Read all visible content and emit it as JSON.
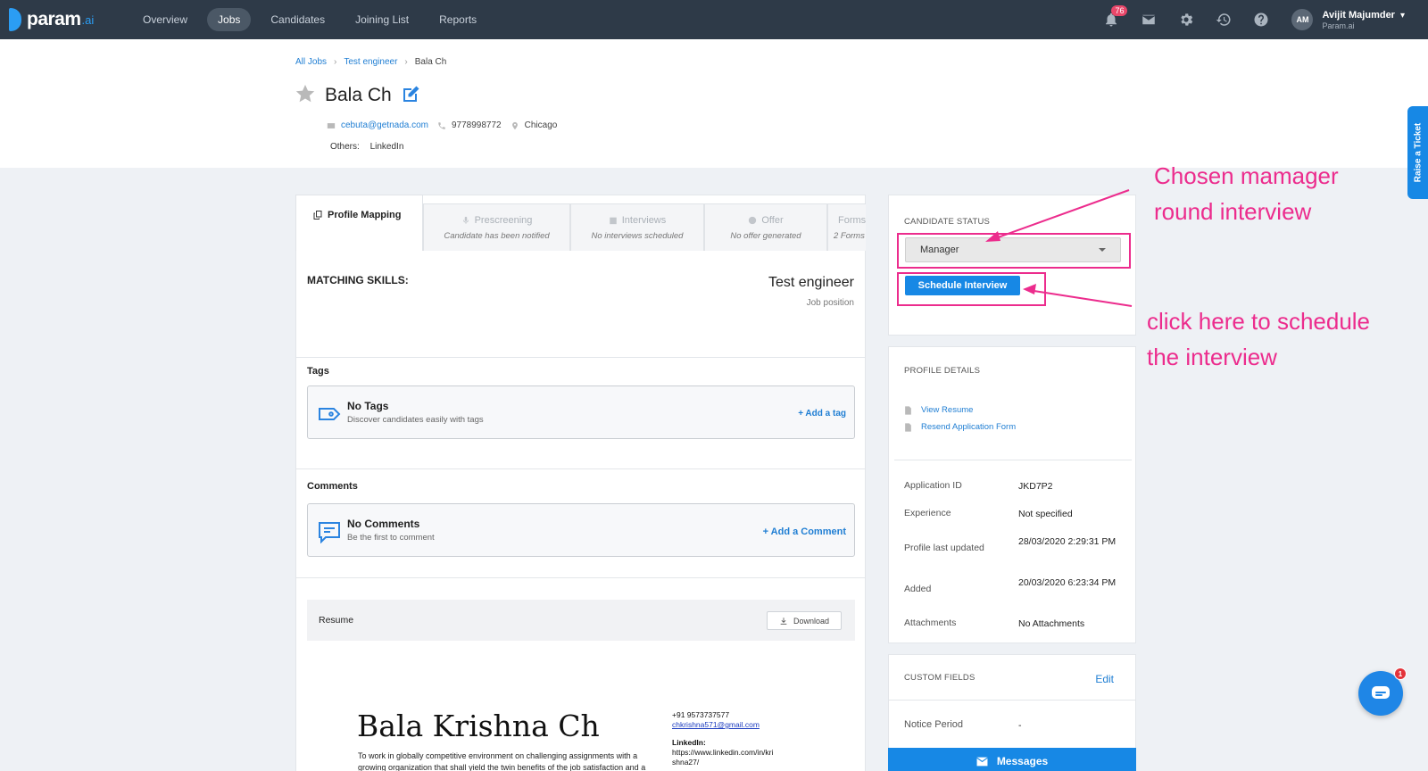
{
  "nav": {
    "logo_text": "param",
    "logo_suffix": ".ai",
    "items": [
      "Overview",
      "Jobs",
      "Candidates",
      "Joining List",
      "Reports"
    ],
    "notification_count": "76",
    "user_initials": "AM",
    "user_name": "Avijit Majumder",
    "user_org": "Param.ai"
  },
  "breadcrumb": {
    "all_jobs": "All Jobs",
    "job": "Test engineer",
    "current": "Bala Ch"
  },
  "candidate": {
    "name": "Bala Ch",
    "email": "cebuta@getnada.com",
    "phone": "9778998772",
    "city": "Chicago",
    "others_label": "Others:",
    "others_value": "LinkedIn"
  },
  "tabs": [
    {
      "title": "Profile Mapping",
      "sub": ""
    },
    {
      "title": "Prescreening",
      "sub": "Candidate has been notified"
    },
    {
      "title": "Interviews",
      "sub": "No interviews scheduled"
    },
    {
      "title": "Offer",
      "sub": "No offer generated"
    },
    {
      "title": "Forms",
      "sub": "2 Forms"
    }
  ],
  "profile": {
    "matching_skills": "MATCHING SKILLS:",
    "job_title": "Test engineer",
    "job_label": "Job position",
    "tags_label": "Tags",
    "tags_empty_title": "No Tags",
    "tags_empty_sub": "Discover candidates easily with tags",
    "tags_action": "+ Add a tag",
    "comments_label": "Comments",
    "comments_empty_title": "No Comments",
    "comments_empty_sub": "Be the first to comment",
    "comments_action": "+ Add a Comment",
    "resume_label": "Resume",
    "download_label": "Download"
  },
  "resume_preview": {
    "name": "Bala Krishna Ch",
    "objective": "To work in globally competitive environment on challenging assignments with a growing organization that shall yield the twin benefits of the job satisfaction and a",
    "phone": "+91 9573737577",
    "email": "chkrishna571@gmail.com",
    "linkedin_label": "LinkedIn:",
    "linkedin_line1": "https://www.linkedin.com/in/kri",
    "linkedin_line2": "shna27/"
  },
  "status_card": {
    "label": "CANDIDATE STATUS",
    "selected": "Manager",
    "schedule_button": "Schedule Interview"
  },
  "profile_details": {
    "label": "PROFILE DETAILS",
    "view_resume": "View Resume",
    "resend_form": "Resend Application Form",
    "rows": [
      {
        "key": "Application ID",
        "value": "JKD7P2"
      },
      {
        "key": "Experience",
        "value": "Not specified"
      },
      {
        "key": "Profile last updated",
        "value": "28/03/2020 2:29:31 PM"
      },
      {
        "key": "Added",
        "value": "20/03/2020 6:23:34 PM"
      },
      {
        "key": "Attachments",
        "value": "No Attachments"
      }
    ]
  },
  "custom_fields": {
    "label": "CUSTOM FIELDS",
    "edit": "Edit",
    "notice_key": "Notice Period",
    "notice_value": "-"
  },
  "messages_label": "Messages",
  "raise_ticket": "Raise a Ticket",
  "chat_badge": "1",
  "annotations": {
    "manager_line1": "Chosen mamager",
    "manager_line2": "round interview",
    "schedule_line1": "click here to schedule",
    "schedule_line2": "the interview"
  },
  "colors": {
    "topbar": "#2e3a48",
    "accent": "#1788e5",
    "annotation": "#ec2c8d"
  }
}
